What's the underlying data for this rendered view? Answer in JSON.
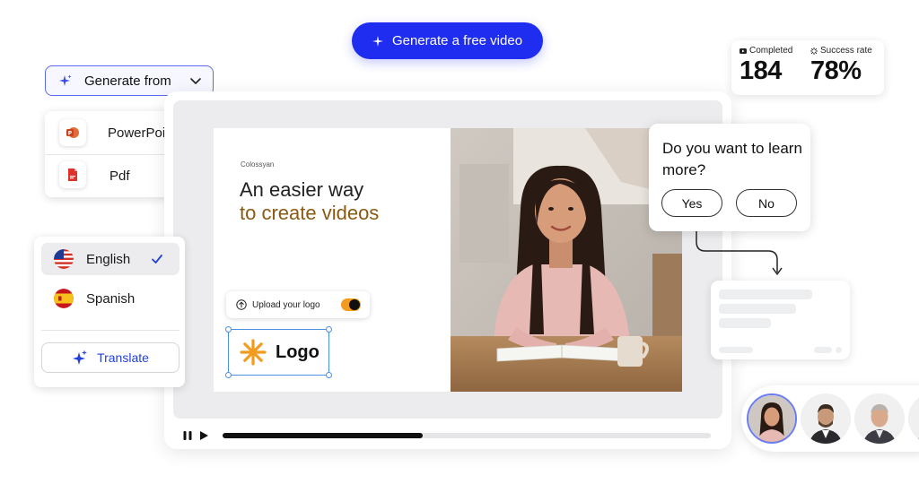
{
  "cta": {
    "label": "Generate a free video"
  },
  "stats": {
    "completed_label": "Completed",
    "completed_value": "184",
    "success_label": "Success rate",
    "success_value": "78%"
  },
  "generate_from": {
    "label": "Generate from",
    "options": [
      {
        "label": "PowerPoint",
        "icon": "powerpoint-icon"
      },
      {
        "label": "Pdf",
        "icon": "pdf-icon"
      }
    ]
  },
  "slide": {
    "brand": "Colossyan",
    "headline_line1": "An easier way",
    "headline_line2": "to create videos",
    "upload_label": "Upload your logo",
    "logo_text": "Logo"
  },
  "player": {
    "progress": 0.41
  },
  "question": {
    "text": "Do you want to learn more?",
    "yes": "Yes",
    "no": "No"
  },
  "languages": {
    "items": [
      {
        "label": "English",
        "selected": true
      },
      {
        "label": "Spanish",
        "selected": false
      }
    ],
    "translate_label": "Translate"
  },
  "colors": {
    "primary": "#1f2df0",
    "accent_orange": "#f29b1e",
    "headline_brown": "#8a5a12",
    "selection_blue": "#4a90e2"
  }
}
